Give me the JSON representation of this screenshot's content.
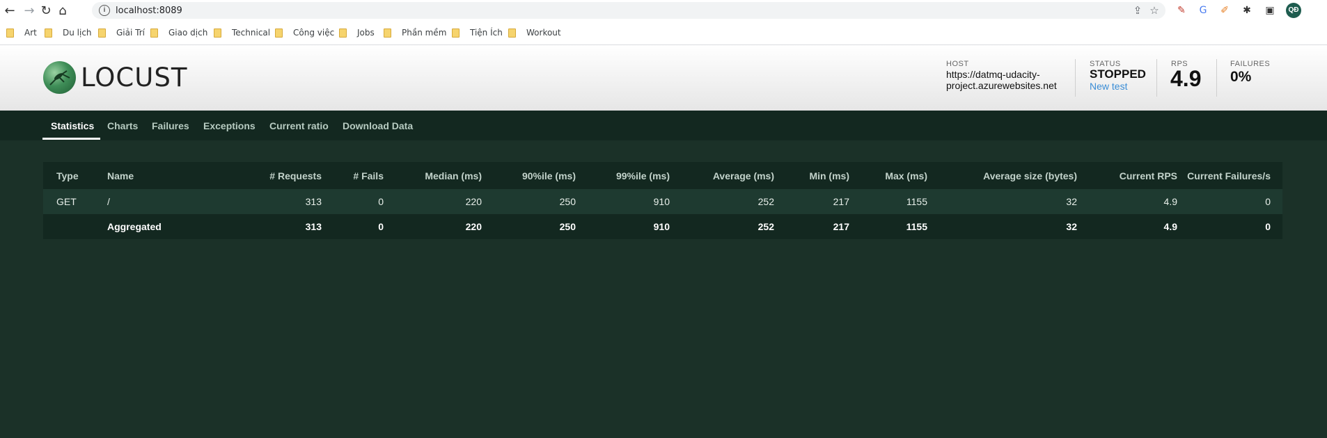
{
  "browser": {
    "url": "localhost:8089",
    "avatar_initials": "QĐ",
    "bookmarks": [
      "Art",
      "Du lịch",
      "Giải Trí",
      "Giao dịch",
      "Technical",
      "Công việc",
      "Jobs",
      "Phần mềm",
      "Tiện Ích",
      "Workout"
    ]
  },
  "header": {
    "logo_text": "LOCUST",
    "host_label": "HOST",
    "host_value": "https://datmq-udacity-project.azurewebsites.net",
    "status_label": "STATUS",
    "status_value": "STOPPED",
    "new_test_label": "New test",
    "rps_label": "RPS",
    "rps_value": "4.9",
    "failures_label": "FAILURES",
    "failures_value": "0%"
  },
  "tabs": [
    "Statistics",
    "Charts",
    "Failures",
    "Exceptions",
    "Current ratio",
    "Download Data"
  ],
  "active_tab": "Statistics",
  "table": {
    "columns": [
      "Type",
      "Name",
      "# Requests",
      "# Fails",
      "Median (ms)",
      "90%ile (ms)",
      "99%ile (ms)",
      "Average (ms)",
      "Min (ms)",
      "Max (ms)",
      "Average size (bytes)",
      "Current RPS",
      "Current Failures/s"
    ],
    "rows": [
      [
        "GET",
        "/",
        "313",
        "0",
        "220",
        "250",
        "910",
        "252",
        "217",
        "1155",
        "32",
        "4.9",
        "0"
      ],
      [
        "",
        "Aggregated",
        "313",
        "0",
        "220",
        "250",
        "910",
        "252",
        "217",
        "1155",
        "32",
        "4.9",
        "0"
      ]
    ]
  },
  "colors": {
    "page_bg": "#1b3128",
    "tab_bar": "#132820",
    "row_alt": "#1e3a30",
    "link": "#3a8dd6"
  }
}
